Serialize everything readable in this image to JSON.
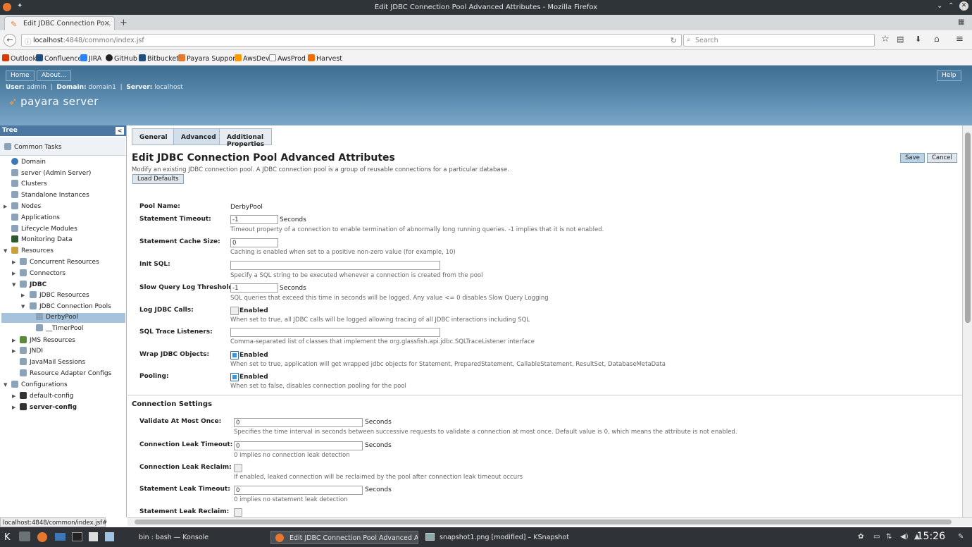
{
  "window": {
    "title": "Edit JDBC Connection Pool Advanced Attributes - Mozilla Firefox"
  },
  "browser": {
    "tab_title": "Edit JDBC Connection Po...",
    "url_host": "localhost",
    "url_path": ":4848/common/index.jsf",
    "search_placeholder": "Search",
    "bookmarks": [
      "Outlook",
      "Confluence",
      "JIRA",
      "GitHub",
      "Bitbucket",
      "Payara Support",
      "AwsDev",
      "AwsProd",
      "Harvest"
    ],
    "status_url": "localhost:4848/common/index.jsf#"
  },
  "header": {
    "home": "Home",
    "about": "About...",
    "help": "Help",
    "user_label": "User:",
    "user": "admin",
    "domain_label": "Domain:",
    "domain": "domain1",
    "server_label": "Server:",
    "server": "localhost",
    "logo": "payara server"
  },
  "tree": {
    "title": "Tree",
    "collapse": "<",
    "items": [
      "Common Tasks",
      "Domain",
      "server (Admin Server)",
      "Clusters",
      "Standalone Instances",
      "Nodes",
      "Applications",
      "Lifecycle Modules",
      "Monitoring Data",
      "Resources",
      "Concurrent Resources",
      "Connectors",
      "JDBC",
      "JDBC Resources",
      "JDBC Connection Pools",
      "DerbyPool",
      "__TimerPool",
      "JMS Resources",
      "JNDI",
      "JavaMail Sessions",
      "Resource Adapter Configs",
      "Configurations",
      "default-config",
      "server-config"
    ]
  },
  "page": {
    "tabs": [
      "General",
      "Advanced",
      "Additional Properties"
    ],
    "title": "Edit JDBC Connection Pool Advanced Attributes",
    "description": "Modify an existing JDBC connection pool. A JDBC connection pool is a group of reusable connections for a particular database.",
    "load_defaults": "Load Defaults",
    "save": "Save",
    "cancel": "Cancel",
    "seconds": "Seconds",
    "enabled": "Enabled",
    "fields": {
      "pool_name": {
        "label": "Pool Name:",
        "value": "DerbyPool"
      },
      "statement_timeout": {
        "label": "Statement Timeout:",
        "value": "-1",
        "help": "Timeout property of a connection to enable termination of abnormally long running queries. -1 implies that it is not enabled."
      },
      "statement_cache": {
        "label": "Statement Cache Size:",
        "value": "0",
        "help": "Caching is enabled when set to a positive non-zero value (for example, 10)"
      },
      "init_sql": {
        "label": "Init SQL:",
        "value": "",
        "help": "Specify a SQL string to be executed whenever a connection is created from the pool"
      },
      "slow_query": {
        "label": "Slow Query Log Threshold:",
        "value": "-1",
        "help": "SQL queries that exceed this time in seconds will be logged. Any value <= 0 disables Slow Query Logging"
      },
      "log_jdbc": {
        "label": "Log JDBC Calls:",
        "checked": false,
        "help": "When set to true, all JDBC calls will be logged allowing tracing of all JDBC interactions including SQL"
      },
      "sql_trace": {
        "label": "SQL Trace Listeners:",
        "value": "",
        "help": "Comma-separated list of classes that implement the org.glassfish.api.jdbc.SQLTraceListener interface"
      },
      "wrap_jdbc": {
        "label": "Wrap JDBC Objects:",
        "checked": true,
        "help": "When set to true, application will get wrapped jdbc objects for Statement, PreparedStatement, CallableStatement, ResultSet, DatabaseMetaData"
      },
      "pooling": {
        "label": "Pooling:",
        "checked": true,
        "help": "When set to false, disables connection pooling for the pool"
      }
    },
    "connection_settings": {
      "title": "Connection Settings",
      "validate": {
        "label": "Validate At Most Once:",
        "value": "0",
        "help": "Specifies the time interval in seconds between successive requests to validate a connection at most once. Default value is 0, which means the attribute is not enabled."
      },
      "leak_timeout": {
        "label": "Connection Leak Timeout:",
        "value": "0",
        "help": "0 implies no connection leak detection"
      },
      "leak_reclaim": {
        "label": "Connection Leak Reclaim:",
        "checked": false,
        "help": "If enabled, leaked connection will be reclaimed by the pool after connection leak timeout occurs"
      },
      "stmt_leak_timeout": {
        "label": "Statement Leak Timeout:",
        "value": "0",
        "help": "0 implies no statement leak detection"
      },
      "stmt_leak_reclaim": {
        "label": "Statement Leak Reclaim:",
        "checked": false
      }
    }
  },
  "taskbar": {
    "tasks": [
      "bin : bash — Konsole",
      "Edit JDBC Connection Pool Advanced Attr",
      "snapshot1.png [modified] – KSnapshot"
    ],
    "clock": "15:26"
  },
  "colors": {
    "header": "#4f7ea4",
    "tree_header": "#4c77a3",
    "selection": "#a7c3dc"
  }
}
